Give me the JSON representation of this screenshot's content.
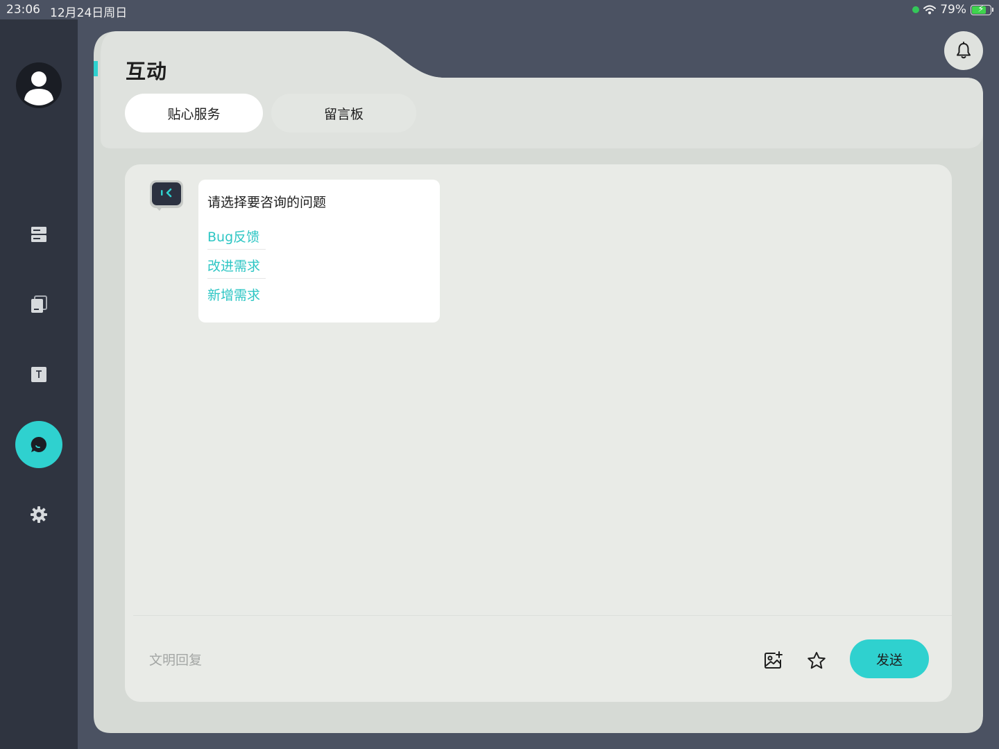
{
  "status_bar": {
    "time": "23:06",
    "date": "12月24日周日",
    "battery": "79%",
    "battery_level": 0.79
  },
  "sidebar": {
    "items": [
      {
        "name": "list",
        "icon": "server-list-icon"
      },
      {
        "name": "copy",
        "icon": "copy-icon"
      },
      {
        "name": "text",
        "icon": "text-box-icon"
      },
      {
        "name": "chat",
        "icon": "chat-bubble-icon",
        "active": true
      },
      {
        "name": "settings",
        "icon": "gear-icon"
      }
    ]
  },
  "header": {
    "title": "互动",
    "tabs": [
      {
        "label": "贴心服务",
        "active": true
      },
      {
        "label": "留言板",
        "active": false
      }
    ]
  },
  "chat": {
    "bot_message": {
      "title": "请选择要咨询的问题",
      "options": [
        "Bug反馈",
        "改进需求",
        "新增需求"
      ]
    },
    "input_placeholder": "文明回复",
    "send_label": "发送"
  },
  "colors": {
    "accent": "#2fd1cf",
    "sidebar_bg": "#2f3440",
    "page_bg": "#4b5262",
    "card_bg": "#dfe2de",
    "panel_bg": "#e9ebe7",
    "link": "#2ec6c4"
  }
}
